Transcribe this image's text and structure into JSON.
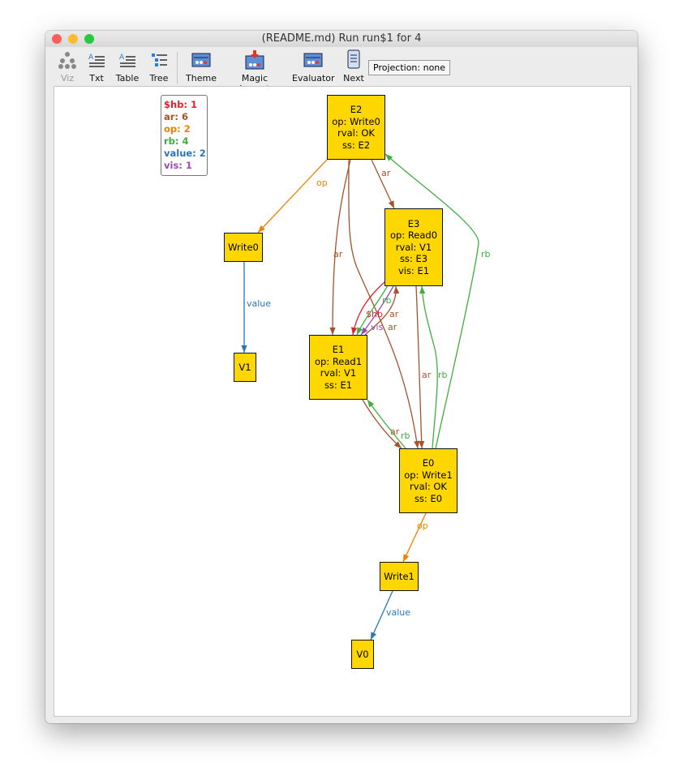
{
  "window": {
    "title": "(README.md) Run run$1 for 4"
  },
  "toolbar": {
    "items": [
      {
        "label": "Viz",
        "icon": "viz-tree-icon",
        "disabled": true
      },
      {
        "label": "Txt",
        "icon": "text-icon"
      },
      {
        "label": "Table",
        "icon": "table-icon"
      },
      {
        "label": "Tree",
        "icon": "tree-icon"
      },
      {
        "label": "Theme",
        "icon": "theme-icon"
      },
      {
        "label": "Magic Layout",
        "icon": "magic-layout-icon"
      },
      {
        "label": "Evaluator",
        "icon": "evaluator-icon"
      },
      {
        "label": "Next",
        "icon": "scroll-icon"
      }
    ],
    "projection": "Projection: none"
  },
  "legend": [
    {
      "text": "$hb: 1",
      "color": "#e0202a"
    },
    {
      "text": "ar: 6",
      "color": "#a5522a"
    },
    {
      "text": "op: 2",
      "color": "#f08000"
    },
    {
      "text": "rb: 4",
      "color": "#3fae3f"
    },
    {
      "text": "value: 2",
      "color": "#2a76b8"
    },
    {
      "text": "vis: 1",
      "color": "#9b4bb0"
    }
  ],
  "nodes": [
    {
      "id": "E2",
      "lines": [
        "E2",
        "op: Write0",
        "rval: OK",
        "ss: E2"
      ]
    },
    {
      "id": "Write0",
      "lines": [
        "Write0"
      ]
    },
    {
      "id": "E3",
      "lines": [
        "E3",
        "op: Read0",
        "rval: V1",
        "ss: E3",
        "vis: E1"
      ]
    },
    {
      "id": "V1",
      "lines": [
        "V1"
      ]
    },
    {
      "id": "E1",
      "lines": [
        "E1",
        "op: Read1",
        "rval: V1",
        "ss: E1"
      ]
    },
    {
      "id": "E0",
      "lines": [
        "E0",
        "op: Write1",
        "rval: OK",
        "ss: E0"
      ]
    },
    {
      "id": "Write1",
      "lines": [
        "Write1"
      ]
    },
    {
      "id": "V0",
      "lines": [
        "V0"
      ]
    }
  ],
  "edges": [
    {
      "from": "E2",
      "to": "Write0",
      "label": "op"
    },
    {
      "from": "Write0",
      "to": "V1",
      "label": "value"
    },
    {
      "from": "E2",
      "to": "E3",
      "label": "ar"
    },
    {
      "from": "E2",
      "to": "E1",
      "label": "ar"
    },
    {
      "from": "E2",
      "to": "E0",
      "label": "ar"
    },
    {
      "from": "E3",
      "to": "E1",
      "label": "$hb"
    },
    {
      "from": "E3",
      "to": "E1",
      "label": "rb"
    },
    {
      "from": "E3",
      "to": "E1",
      "label": "vis"
    },
    {
      "from": "E1",
      "to": "E3",
      "label": "ar"
    },
    {
      "from": "E3",
      "to": "E0",
      "label": "ar"
    },
    {
      "from": "E0",
      "to": "E3",
      "label": "rb"
    },
    {
      "from": "E0",
      "to": "E2",
      "label": "rb"
    },
    {
      "from": "E1",
      "to": "E0",
      "label": "ar"
    },
    {
      "from": "E0",
      "to": "E1",
      "label": "rb"
    },
    {
      "from": "E0",
      "to": "Write1",
      "label": "op"
    },
    {
      "from": "Write1",
      "to": "V0",
      "label": "value"
    }
  ],
  "colors": {
    "ar": "#a5522a",
    "rb": "#3fae3f",
    "op": "#f08000",
    "value": "#2a76b8",
    "$hb": "#e0202a",
    "vis": "#9b4bb0",
    "node": "#ffd700"
  }
}
